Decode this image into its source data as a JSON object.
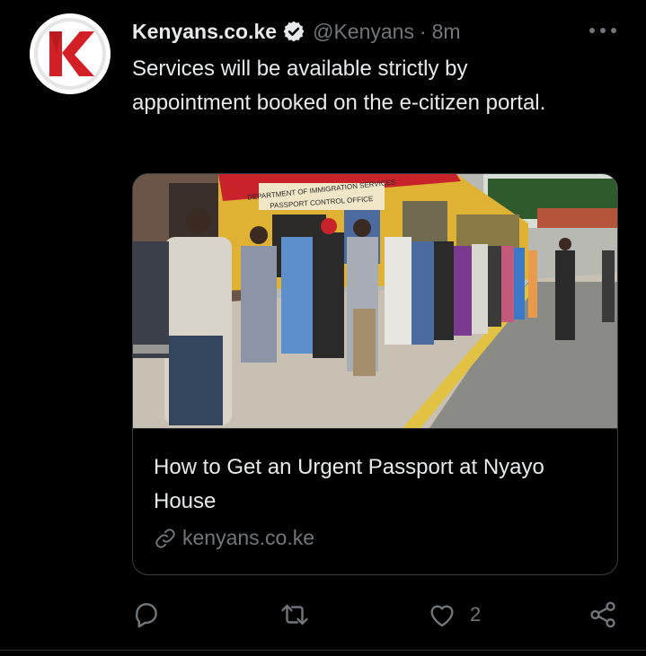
{
  "tweet": {
    "display_name": "Kenyans.co.ke",
    "handle": "@Kenyans",
    "separator": "·",
    "time": "8m",
    "text": "Services will be available strictly by appointment booked on the e-citizen portal.",
    "verified": true
  },
  "card": {
    "title": "How to Get an Urgent Passport at Nyayo House",
    "domain": "kenyans.co.ke",
    "image_sign_line1": "DEPARTMENT OF IMMIGRATION SERVICES",
    "image_sign_line2": "PASSPORT CONTROL OFFICE"
  },
  "actions": {
    "reply_icon": "reply-icon",
    "retweet_icon": "retweet-icon",
    "like_icon": "heart-icon",
    "like_count": "2",
    "share_icon": "share-icon"
  },
  "colors": {
    "background": "#000000",
    "text": "#e7e9ea",
    "muted": "#71767b",
    "verified_badge": "#e7e9ea",
    "brand_red": "#d32027"
  }
}
